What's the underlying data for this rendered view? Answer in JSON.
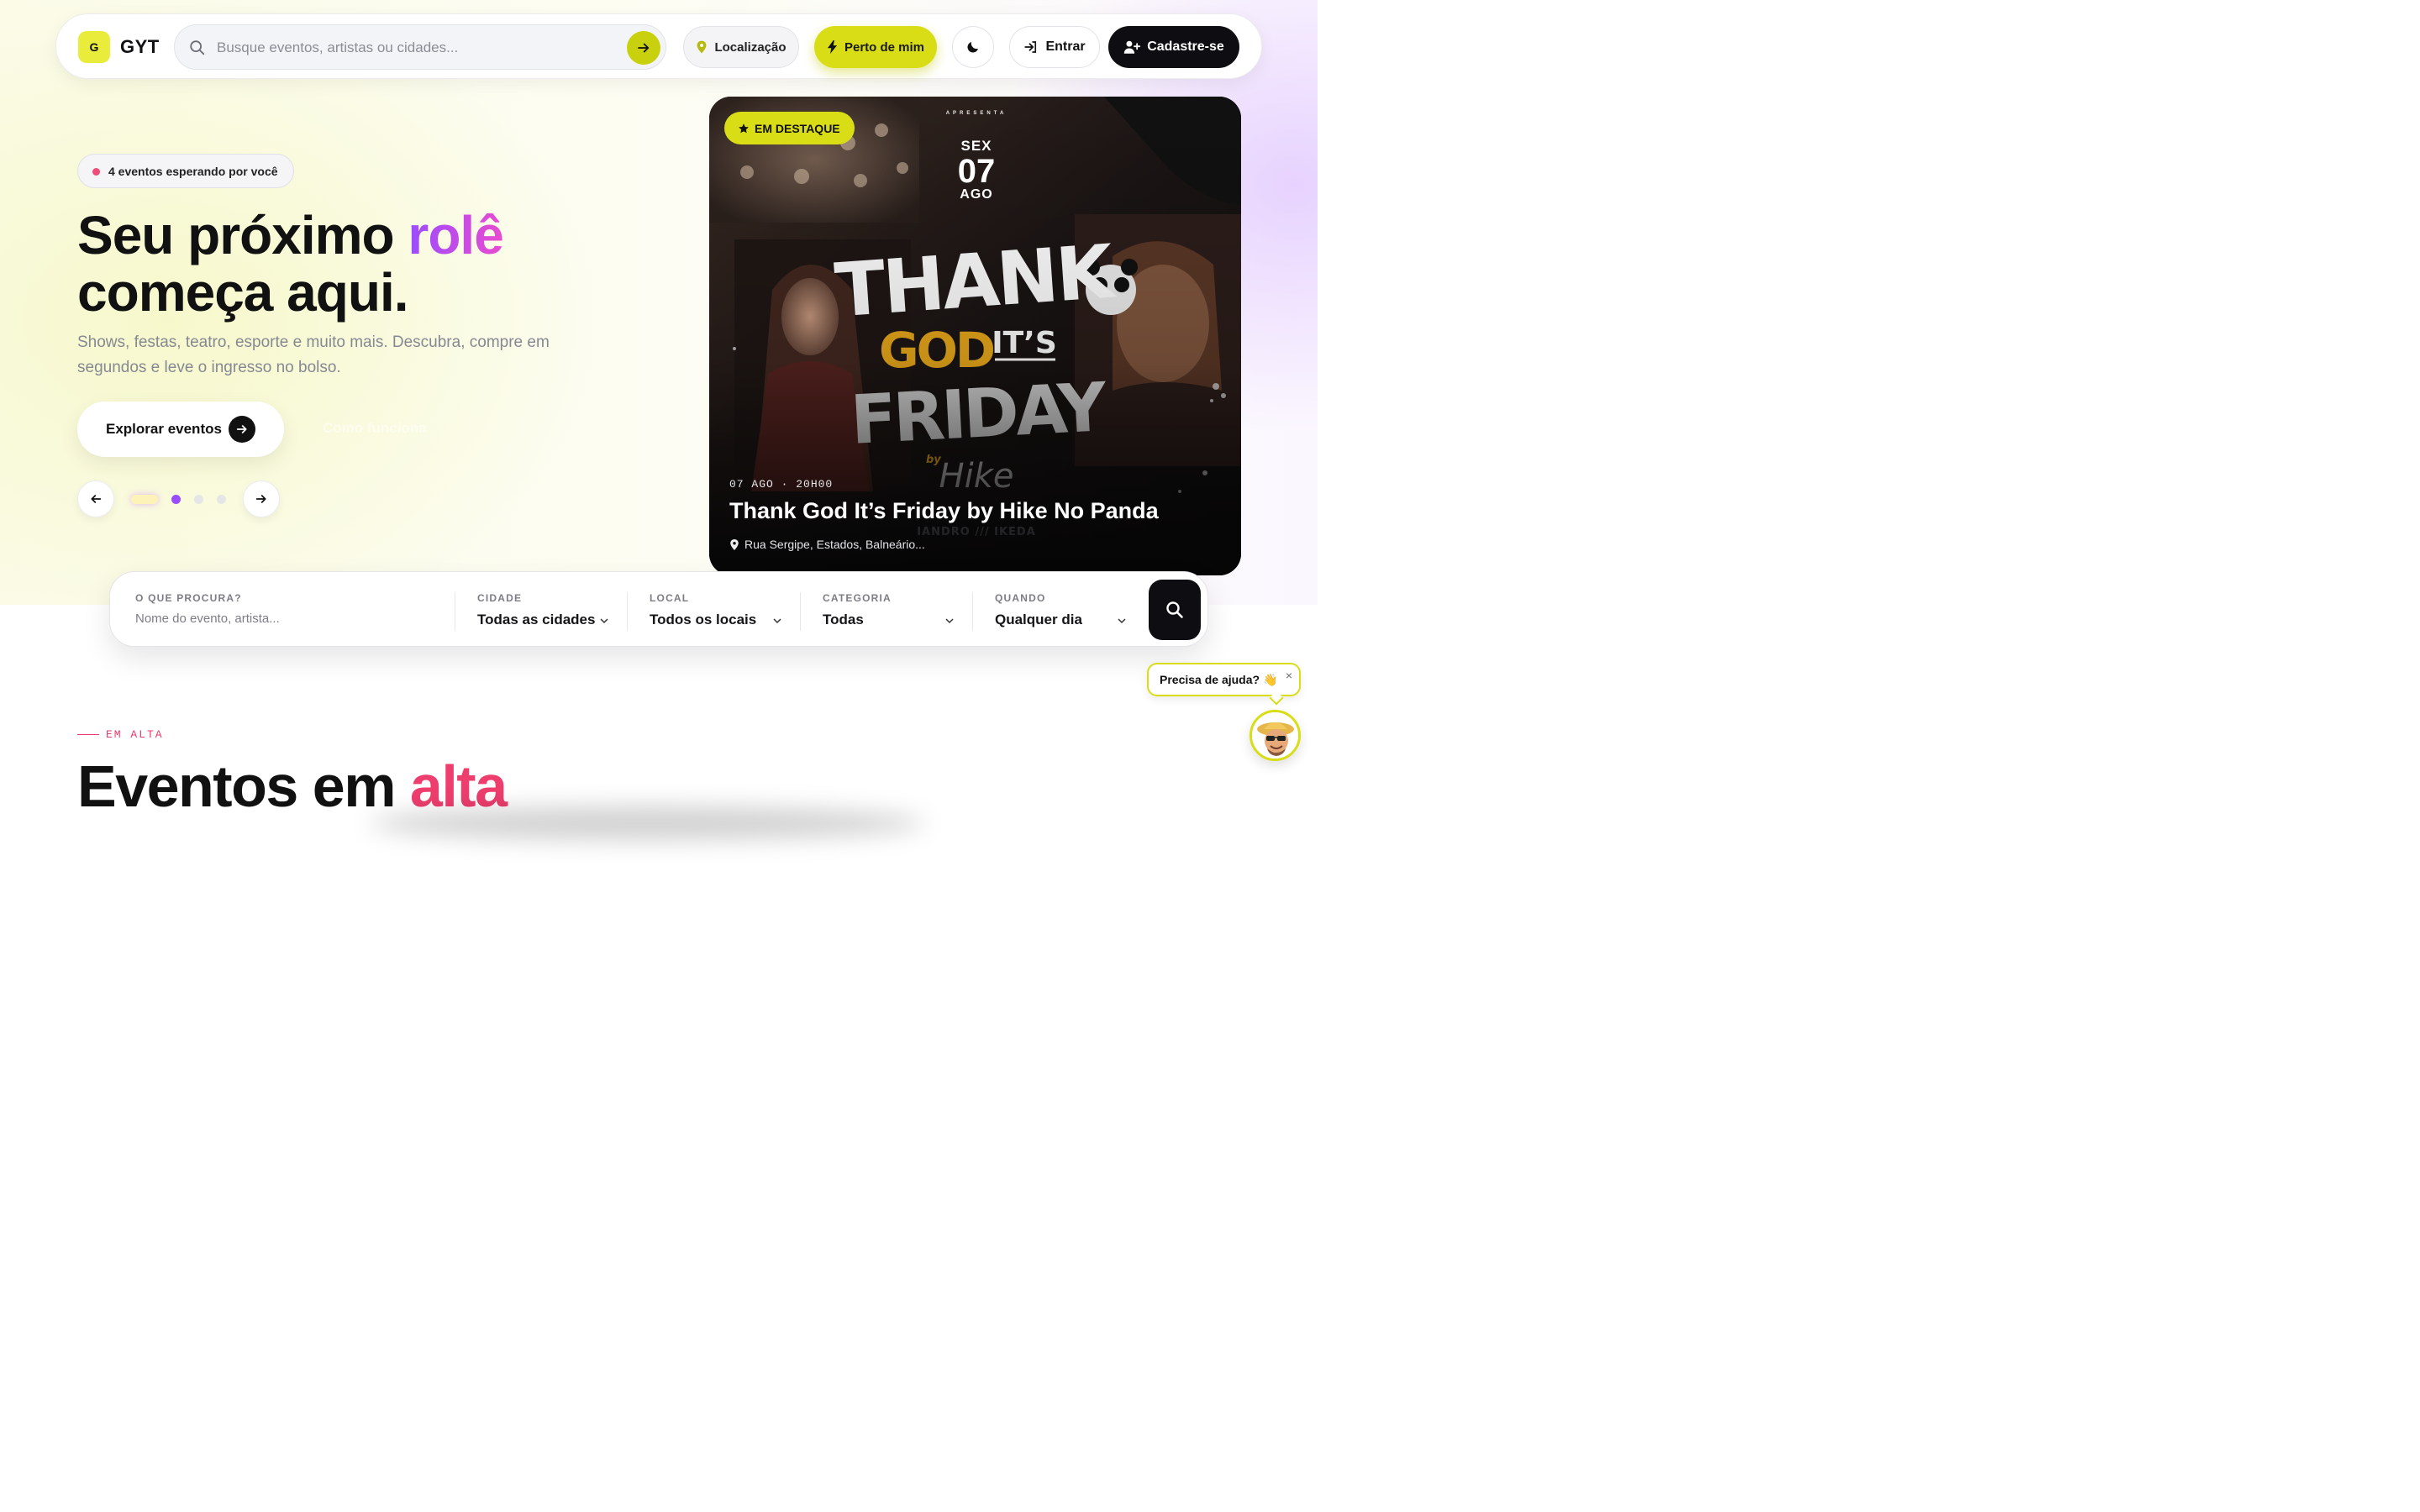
{
  "header": {
    "logo_letter": "G",
    "logo_text": "GYT",
    "search_placeholder": "Busque eventos, artistas ou cidades...",
    "location_label": "Localização",
    "near_me_label": "Perto de mim",
    "login_label": "Entrar",
    "signup_label": "Cadastre-se"
  },
  "hero": {
    "badge": "4 eventos esperando por você",
    "title_part1": "Seu próximo ",
    "title_accent": "rolê",
    "title_part2": "começa aqui.",
    "subtitle": "Shows, festas, teatro, esporte e muito mais. Descubra, compre em segundos e leve o ingresso no bolso.",
    "explore_label": "Explorar eventos",
    "ghost_label": "Como funciona",
    "carousel_total": 4,
    "carousel_active": 1
  },
  "featured": {
    "badge": "EM DESTAQUE",
    "presents": "APRESENTA",
    "weekday": "SEX",
    "day": "07",
    "month": "AGO",
    "meta": "07 AGO · 20H00",
    "title": "Thank God It’s Friday by Hike No Panda",
    "location": "Rua Sergipe, Estados, Balneário..."
  },
  "filters": {
    "what_label": "O QUE PROCURA?",
    "what_placeholder": "Nome do evento, artista...",
    "city_label": "CIDADE",
    "city_value": "Todas as cidades",
    "place_label": "LOCAL",
    "place_value": "Todos os locais",
    "category_label": "CATEGORIA",
    "category_value": "Todas",
    "when_label": "QUANDO",
    "when_value": "Qualquer dia"
  },
  "trending": {
    "kicker": "EM ALTA",
    "title_part1": "Eventos em ",
    "title_accent": "alta"
  },
  "help": {
    "bubble": "Precisa de ajuda? 👋",
    "close": "×"
  },
  "colors": {
    "accent_yellow": "#d8dd16",
    "accent_pink": "#ee3e6e",
    "accent_purple": "#9a4dff",
    "dark": "#0d0d12"
  }
}
